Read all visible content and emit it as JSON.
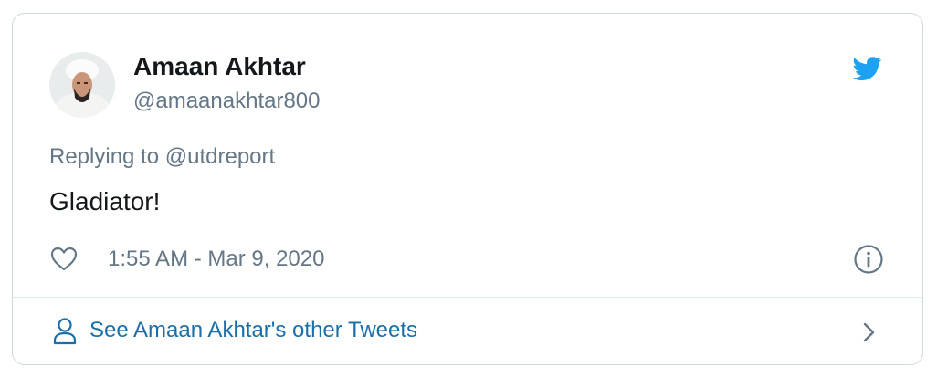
{
  "tweet": {
    "author_name": "Amaan Akhtar",
    "author_handle": "@amaanakhtar800",
    "reply_prefix": "Replying to ",
    "reply_to": "@utdreport",
    "text": "Gladiator!",
    "timestamp": "1:55 AM - Mar 9, 2020"
  },
  "footer": {
    "label": "See Amaan Akhtar's other Tweets"
  },
  "icons": {
    "brand": "twitter-bird-icon",
    "like": "heart-icon",
    "info": "info-icon",
    "profile": "person-icon",
    "more": "chevron-right-icon"
  },
  "colors": {
    "twitter_blue": "#1da1f2",
    "link_blue": "#1b6fa8",
    "muted_text": "#657786",
    "primary_text": "#14171a",
    "border": "#cfd9de"
  }
}
